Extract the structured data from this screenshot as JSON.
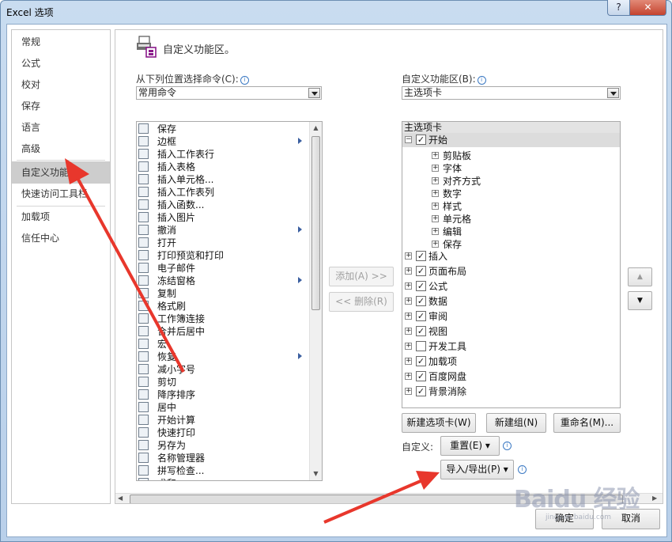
{
  "window": {
    "title": "Excel 选项",
    "help_label": "?",
    "close_label": "✕"
  },
  "nav": {
    "items": [
      {
        "label": "常规"
      },
      {
        "label": "公式"
      },
      {
        "label": "校对"
      },
      {
        "label": "保存"
      },
      {
        "label": "语言"
      },
      {
        "label": "高级"
      },
      {
        "label": "自定义功能区"
      },
      {
        "label": "快速访问工具栏"
      },
      {
        "label": "加载项"
      },
      {
        "label": "信任中心"
      }
    ],
    "selected": "自定义功能区"
  },
  "section": {
    "title": "自定义功能区。"
  },
  "choose_from": {
    "label": "从下列位置选择命令(C):",
    "value": "常用命令"
  },
  "customize_ribbon": {
    "label": "自定义功能区(B):",
    "value": "主选项卡"
  },
  "commands": [
    {
      "label": "保存",
      "icon": "save-icon",
      "submenu": false
    },
    {
      "label": "边框",
      "icon": "border-icon",
      "submenu": true
    },
    {
      "label": "插入工作表行",
      "icon": "insert-row-icon",
      "submenu": false
    },
    {
      "label": "插入表格",
      "icon": "table-icon",
      "submenu": false
    },
    {
      "label": "插入单元格...",
      "icon": "insert-cell-icon",
      "submenu": false
    },
    {
      "label": "插入工作表列",
      "icon": "insert-column-icon",
      "submenu": false
    },
    {
      "label": "插入函数...",
      "icon": "function-icon",
      "submenu": false
    },
    {
      "label": "插入图片",
      "icon": "picture-icon",
      "submenu": false
    },
    {
      "label": "撤消",
      "icon": "undo-icon",
      "submenu": true
    },
    {
      "label": "打开",
      "icon": "folder-icon",
      "submenu": false
    },
    {
      "label": "打印预览和打印",
      "icon": "print-preview-icon",
      "submenu": false
    },
    {
      "label": "电子邮件",
      "icon": "email-icon",
      "submenu": false
    },
    {
      "label": "冻结窗格",
      "icon": "freeze-panes-icon",
      "submenu": true
    },
    {
      "label": "复制",
      "icon": "copy-icon",
      "submenu": false
    },
    {
      "label": "格式刷",
      "icon": "format-painter-icon",
      "submenu": false
    },
    {
      "label": "工作簿连接",
      "icon": "connections-icon",
      "submenu": false
    },
    {
      "label": "合并后居中",
      "icon": "merge-center-icon",
      "submenu": false
    },
    {
      "label": "宏",
      "icon": "macro-icon",
      "submenu": false
    },
    {
      "label": "恢复",
      "icon": "redo-icon",
      "submenu": true
    },
    {
      "label": "减小字号",
      "icon": "decrease-font-icon",
      "submenu": false
    },
    {
      "label": "剪切",
      "icon": "cut-icon",
      "submenu": false
    },
    {
      "label": "降序排序",
      "icon": "sort-desc-icon",
      "submenu": false
    },
    {
      "label": "居中",
      "icon": "center-icon",
      "submenu": false
    },
    {
      "label": "开始计算",
      "icon": "calculate-icon",
      "submenu": false
    },
    {
      "label": "快速打印",
      "icon": "quick-print-icon",
      "submenu": false
    },
    {
      "label": "另存为",
      "icon": "save-as-icon",
      "submenu": false
    },
    {
      "label": "名称管理器",
      "icon": "name-manager-icon",
      "submenu": false
    },
    {
      "label": "拼写检查...",
      "icon": "spelling-icon",
      "submenu": false
    },
    {
      "label": "求和",
      "icon": "sum-icon",
      "submenu": false
    }
  ],
  "buttons": {
    "add": "添加(A) >>",
    "remove": "<< 删除(R)",
    "new_tab": "新建选项卡(W)",
    "new_group": "新建组(N)",
    "rename": "重命名(M)...",
    "reset": "重置(E)",
    "import_export": "导入/导出(P)",
    "ok": "确定",
    "cancel": "取消",
    "move_up": "▲",
    "move_down": "▼"
  },
  "tree": {
    "header": "主选项卡",
    "expanded_tab": {
      "label": "开始",
      "checked": true,
      "groups": [
        "剪贴板",
        "字体",
        "对齐方式",
        "数字",
        "样式",
        "单元格",
        "编辑",
        "保存"
      ]
    },
    "tabs": [
      {
        "label": "插入",
        "checked": true
      },
      {
        "label": "页面布局",
        "checked": true
      },
      {
        "label": "公式",
        "checked": true
      },
      {
        "label": "数据",
        "checked": true
      },
      {
        "label": "审阅",
        "checked": true
      },
      {
        "label": "视图",
        "checked": true
      },
      {
        "label": "开发工具",
        "checked": false
      },
      {
        "label": "加载项",
        "checked": true
      },
      {
        "label": "百度网盘",
        "checked": true
      },
      {
        "label": "背景消除",
        "checked": true
      }
    ]
  },
  "customizations": {
    "label": "自定义:"
  },
  "watermark": {
    "text": "Baidu 经验",
    "sub": "jingyan.baidu.com"
  },
  "colors": {
    "selection": "#cdcdcd",
    "arrow": "#e8372c",
    "title_bar": "#c9dcf0"
  }
}
